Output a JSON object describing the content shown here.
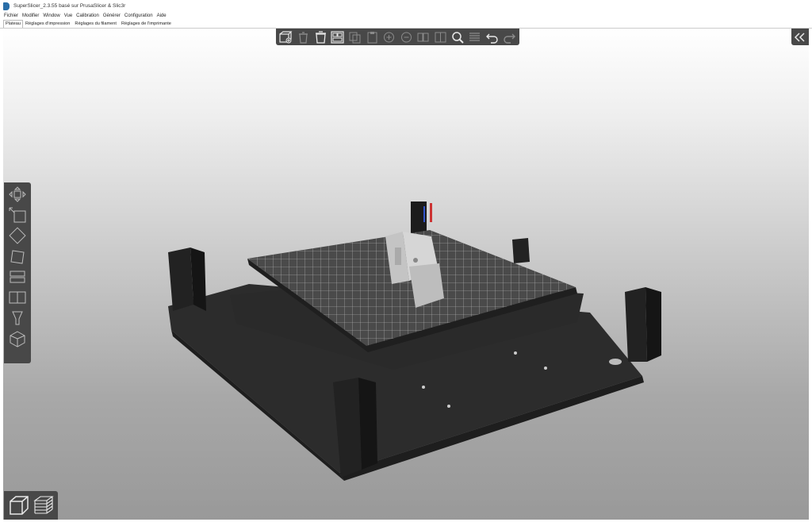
{
  "window": {
    "title": "SuperSlicer_2.3.55 basé sur PrusaSlicer & Slic3r"
  },
  "menu": [
    "Fichier",
    "Modifier",
    "Window",
    "Vue",
    "Calibration",
    "Générer",
    "Configuration",
    "Aide"
  ],
  "tabs": [
    {
      "label": "Plateau",
      "active": true
    },
    {
      "label": "Réglages d'impression",
      "active": false
    },
    {
      "label": "Réglages du filament",
      "active": false
    },
    {
      "label": "Réglages de l'imprimante",
      "active": false
    }
  ],
  "top_toolbar": {
    "buttons": [
      {
        "icon": "add-object-icon",
        "enabled": true
      },
      {
        "icon": "delete-icon",
        "enabled": false
      },
      {
        "icon": "delete-all-icon",
        "enabled": true
      },
      {
        "icon": "arrange-icon",
        "enabled": true
      },
      {
        "icon": "copy-icon",
        "enabled": false
      },
      {
        "icon": "paste-icon",
        "enabled": false
      },
      {
        "icon": "add-instance-icon",
        "enabled": false
      },
      {
        "icon": "remove-instance-icon",
        "enabled": false
      },
      {
        "icon": "split-objects-icon",
        "enabled": false
      },
      {
        "icon": "split-parts-icon",
        "enabled": false
      },
      {
        "icon": "search-icon",
        "enabled": true
      },
      {
        "icon": "layers-editing-icon",
        "enabled": false
      },
      {
        "icon": "undo-icon",
        "enabled": true
      },
      {
        "icon": "redo-icon",
        "enabled": false
      }
    ]
  },
  "left_toolbar": {
    "tools": [
      "move-icon",
      "scale-icon",
      "rotate-icon",
      "place-on-face-icon",
      "cut-icon",
      "support-paint-icon",
      "seam-paint-icon"
    ]
  },
  "bottom_views": [
    "3d-view-icon",
    "preview-layers-icon"
  ],
  "colors": {
    "toolbar_bg": "#484848",
    "icon_enabled": "#e8e8e8",
    "icon_disabled": "#8a8a8a",
    "bed_surface": "#4a4a4a",
    "bed_grid": "#d8d8d8",
    "frame": "#2e2e2e",
    "model": "#c8c8c8",
    "axis_x": "#cc3333",
    "axis_y": "#33aa33",
    "axis_z": "#3355cc"
  }
}
